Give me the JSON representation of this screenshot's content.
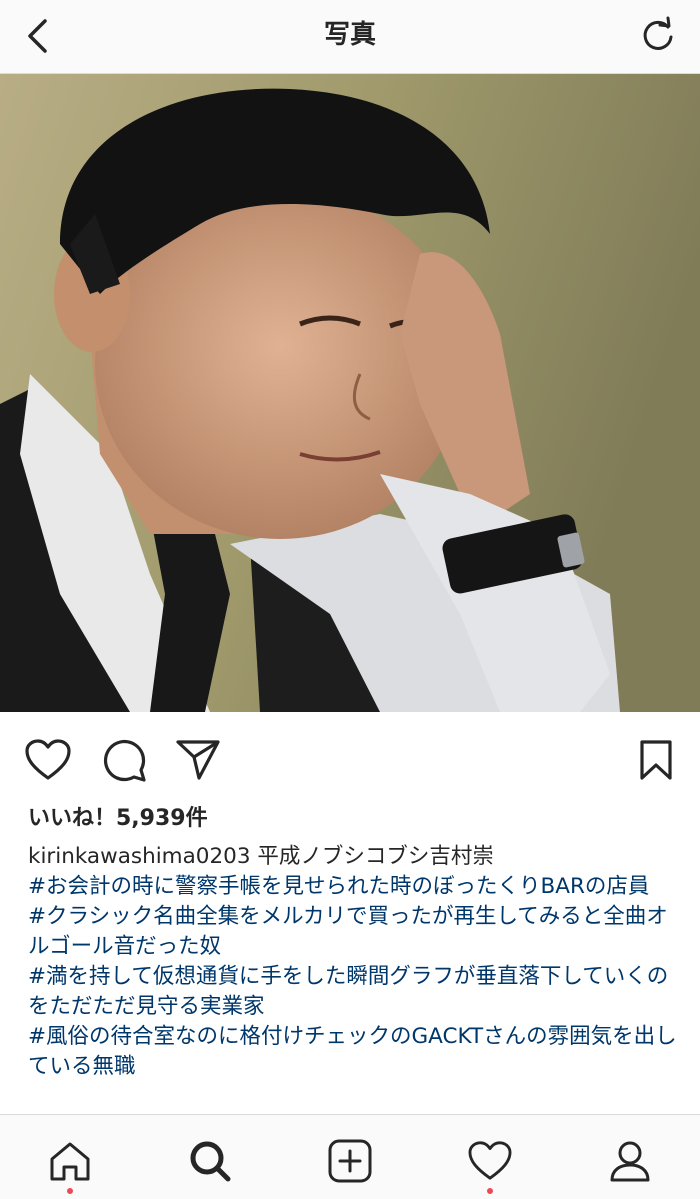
{
  "header": {
    "title": "写真",
    "back_icon": "chevron-left-icon",
    "refresh_icon": "refresh-icon"
  },
  "post": {
    "likes": "いいね！5,939件",
    "username": "kirinkawashima0203",
    "caption_text": "平成ノブシコブシ吉村崇",
    "hashtags": [
      "#お会計の時に警察手帳を見せられた時のぼったくりBARの店員",
      "#クラシック名曲全集をメルカリで買ったが再生してみると全曲オルゴール音だった奴",
      "#満を持して仮想通貨に手をした瞬間グラフが垂直落下していくのをただただ見守る実業家",
      "#風俗の待合室なのに格付けチェックのGACKTさんの雰囲気を出している無職"
    ]
  },
  "colors": {
    "hashtag": "#00376b",
    "text": "#262626",
    "notification_dot": "#ed4956",
    "bar_background": "#fafafa"
  },
  "bottom_nav": {
    "items": [
      "home-icon",
      "search-icon",
      "add-post-icon",
      "activity-heart-icon",
      "profile-icon"
    ]
  }
}
